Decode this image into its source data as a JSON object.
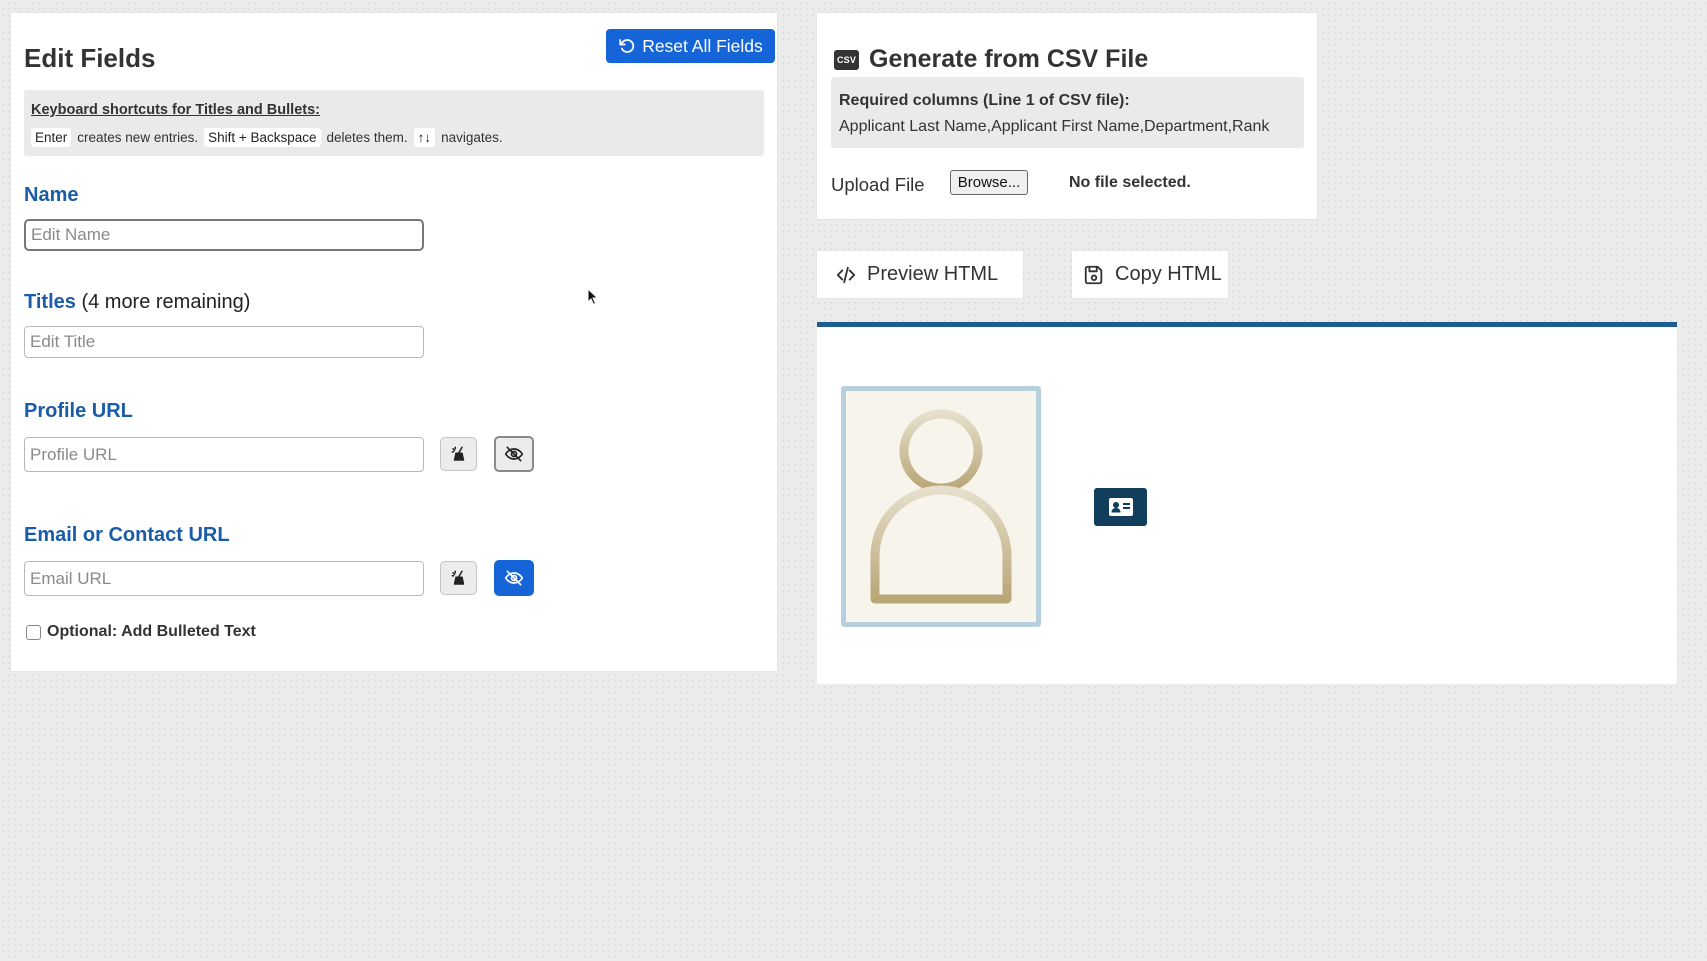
{
  "edit_panel": {
    "title": "Edit Fields",
    "reset_label": "Reset All Fields",
    "shortcuts": {
      "title": "Keyboard shortcuts for Titles and Bullets:",
      "key_enter": "Enter",
      "text_enter": "creates new entries.",
      "key_delete": "Shift + Backspace",
      "text_delete": "deletes them.",
      "key_nav": "↑↓",
      "text_nav": "navigates."
    },
    "name": {
      "label": "Name",
      "placeholder": "Edit Name",
      "value": ""
    },
    "titles": {
      "label": "Titles",
      "remaining": "(4 more remaining)",
      "placeholder": "Edit Title",
      "value": ""
    },
    "profile_url": {
      "label": "Profile URL",
      "placeholder": "Profile URL",
      "value": "",
      "visibility_state": "hidden-outlined"
    },
    "email_url": {
      "label": "Email or Contact URL",
      "placeholder": "Email URL",
      "value": "",
      "visibility_state": "hidden-active"
    },
    "bulleted_text": {
      "label": "Optional: Add Bulleted Text",
      "checked": false
    }
  },
  "csv_panel": {
    "badge": "CSV",
    "title": "Generate from CSV File",
    "required_title": "Required columns (Line 1 of CSV file):",
    "required_columns": "Applicant Last Name,Applicant First Name,Department,Rank",
    "upload_label": "Upload File",
    "browse_label": "Browse...",
    "file_status": "No file selected."
  },
  "actions": {
    "preview_label": "Preview HTML",
    "copy_label": "Copy HTML"
  },
  "colors": {
    "primary": "#1565d8",
    "label_blue": "#1a5ca8",
    "preview_border": "#1b5e8f",
    "vcard_bg": "#103e5c",
    "avatar_border": "#b8cfdd",
    "avatar_figure": "#cbbd95"
  },
  "icons": {
    "reset": "rotate-ccw-icon",
    "clear": "broom-icon",
    "visibility": "eye-off-icon",
    "preview": "code-icon",
    "copy": "floppy-disk-icon",
    "vcard": "id-card-icon",
    "avatar": "person-placeholder-icon"
  }
}
